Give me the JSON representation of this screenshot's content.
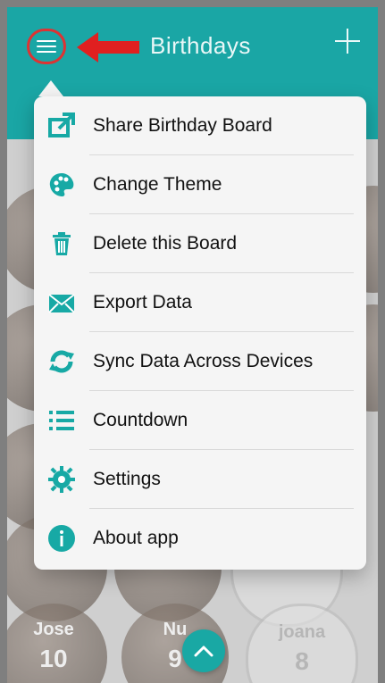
{
  "header": {
    "title": "Birthdays"
  },
  "menu": {
    "items": [
      {
        "label": "Share Birthday Board",
        "icon": "share-icon"
      },
      {
        "label": "Change Theme",
        "icon": "palette-icon"
      },
      {
        "label": "Delete this Board",
        "icon": "trash-icon"
      },
      {
        "label": "Export Data",
        "icon": "mail-icon"
      },
      {
        "label": "Sync Data Across Devices",
        "icon": "sync-icon"
      },
      {
        "label": "Countdown",
        "icon": "list-icon"
      },
      {
        "label": "Settings",
        "icon": "gear-icon"
      },
      {
        "label": "About app",
        "icon": "info-icon"
      }
    ]
  },
  "board": {
    "cards": [
      {
        "name": "Jose",
        "number": "10"
      },
      {
        "name": "Nu",
        "number": "9"
      },
      {
        "name": "joana",
        "number": "8"
      }
    ]
  },
  "colors": {
    "accent": "#1aa6a5",
    "menu_background": "#f5f5f5",
    "annotation_red": "#e02020"
  }
}
